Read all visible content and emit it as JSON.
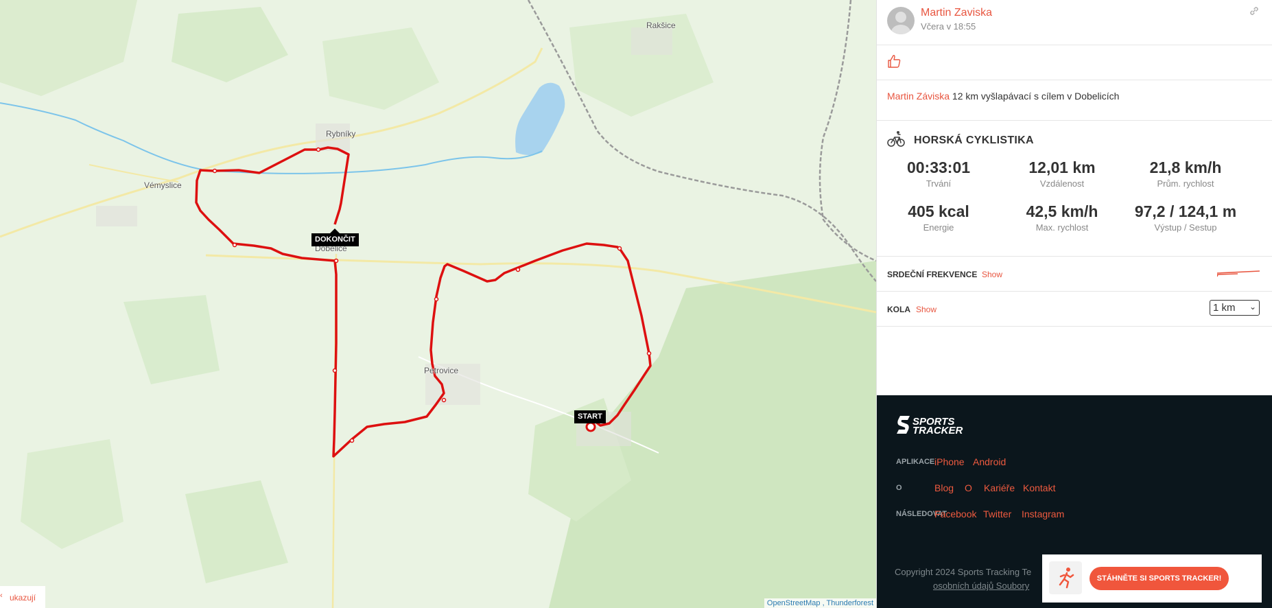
{
  "map": {
    "places": [
      {
        "name": "Rakšice"
      },
      {
        "name": "Rybníky"
      },
      {
        "name": "Vémyslice"
      },
      {
        "name": "Dobelice"
      },
      {
        "name": "Petrovice"
      }
    ],
    "start_label": "START",
    "finish_label": "DOKONČIT",
    "toggle_label": "ukazují",
    "attribution": "OpenStreetMap , Thunderforest"
  },
  "header": {
    "user_name": "Martin Zaviska",
    "time": "Včera v 18:55"
  },
  "description": {
    "user": "Martin Záviska",
    "text": " 12 km vyšlapávací s cílem v Dobelicích"
  },
  "activity": {
    "sport": "HORSKÁ CYKLISTIKA",
    "stats": [
      {
        "value": "00:33:01",
        "label": "Trvání"
      },
      {
        "value": "12,01  km",
        "label": "Vzdálenost"
      },
      {
        "value": "21,8  km/h",
        "label": "Prům. rychlost"
      },
      {
        "value": "405 kcal",
        "label": "Energie"
      },
      {
        "value": "42,5  km/h",
        "label": "Max. rychlost"
      },
      {
        "value": "97,2 / 124,1  m",
        "label": "Výstup / Sestup"
      }
    ]
  },
  "heart_rate": {
    "title": "SRDEČNÍ FREKVENCE",
    "link": "Show"
  },
  "laps": {
    "title": "KOLA",
    "link": "Show",
    "selected": "1 km"
  },
  "footer": {
    "logo_line1": "SPORTS",
    "logo_line2": "TRACKER",
    "apps_label": "APLIKACE",
    "apps": [
      "iPhone",
      "Android"
    ],
    "about_label": "O",
    "about": [
      "Blog",
      "O",
      "Kariéře",
      "Kontakt"
    ],
    "follow_label": "NÁSLEDOVAT",
    "follow": [
      "Facebook",
      "Twitter",
      "Instagram"
    ],
    "copyright": "Copyright 2024 Sports Tracking Te",
    "privacy": "osobních údajů Soubory",
    "download_button": "STÁHNĚTE SI SPORTS TRACKER!"
  },
  "colors": {
    "accent": "#e8553f",
    "route": "#e01010",
    "footer_bg": "#0b161c"
  }
}
